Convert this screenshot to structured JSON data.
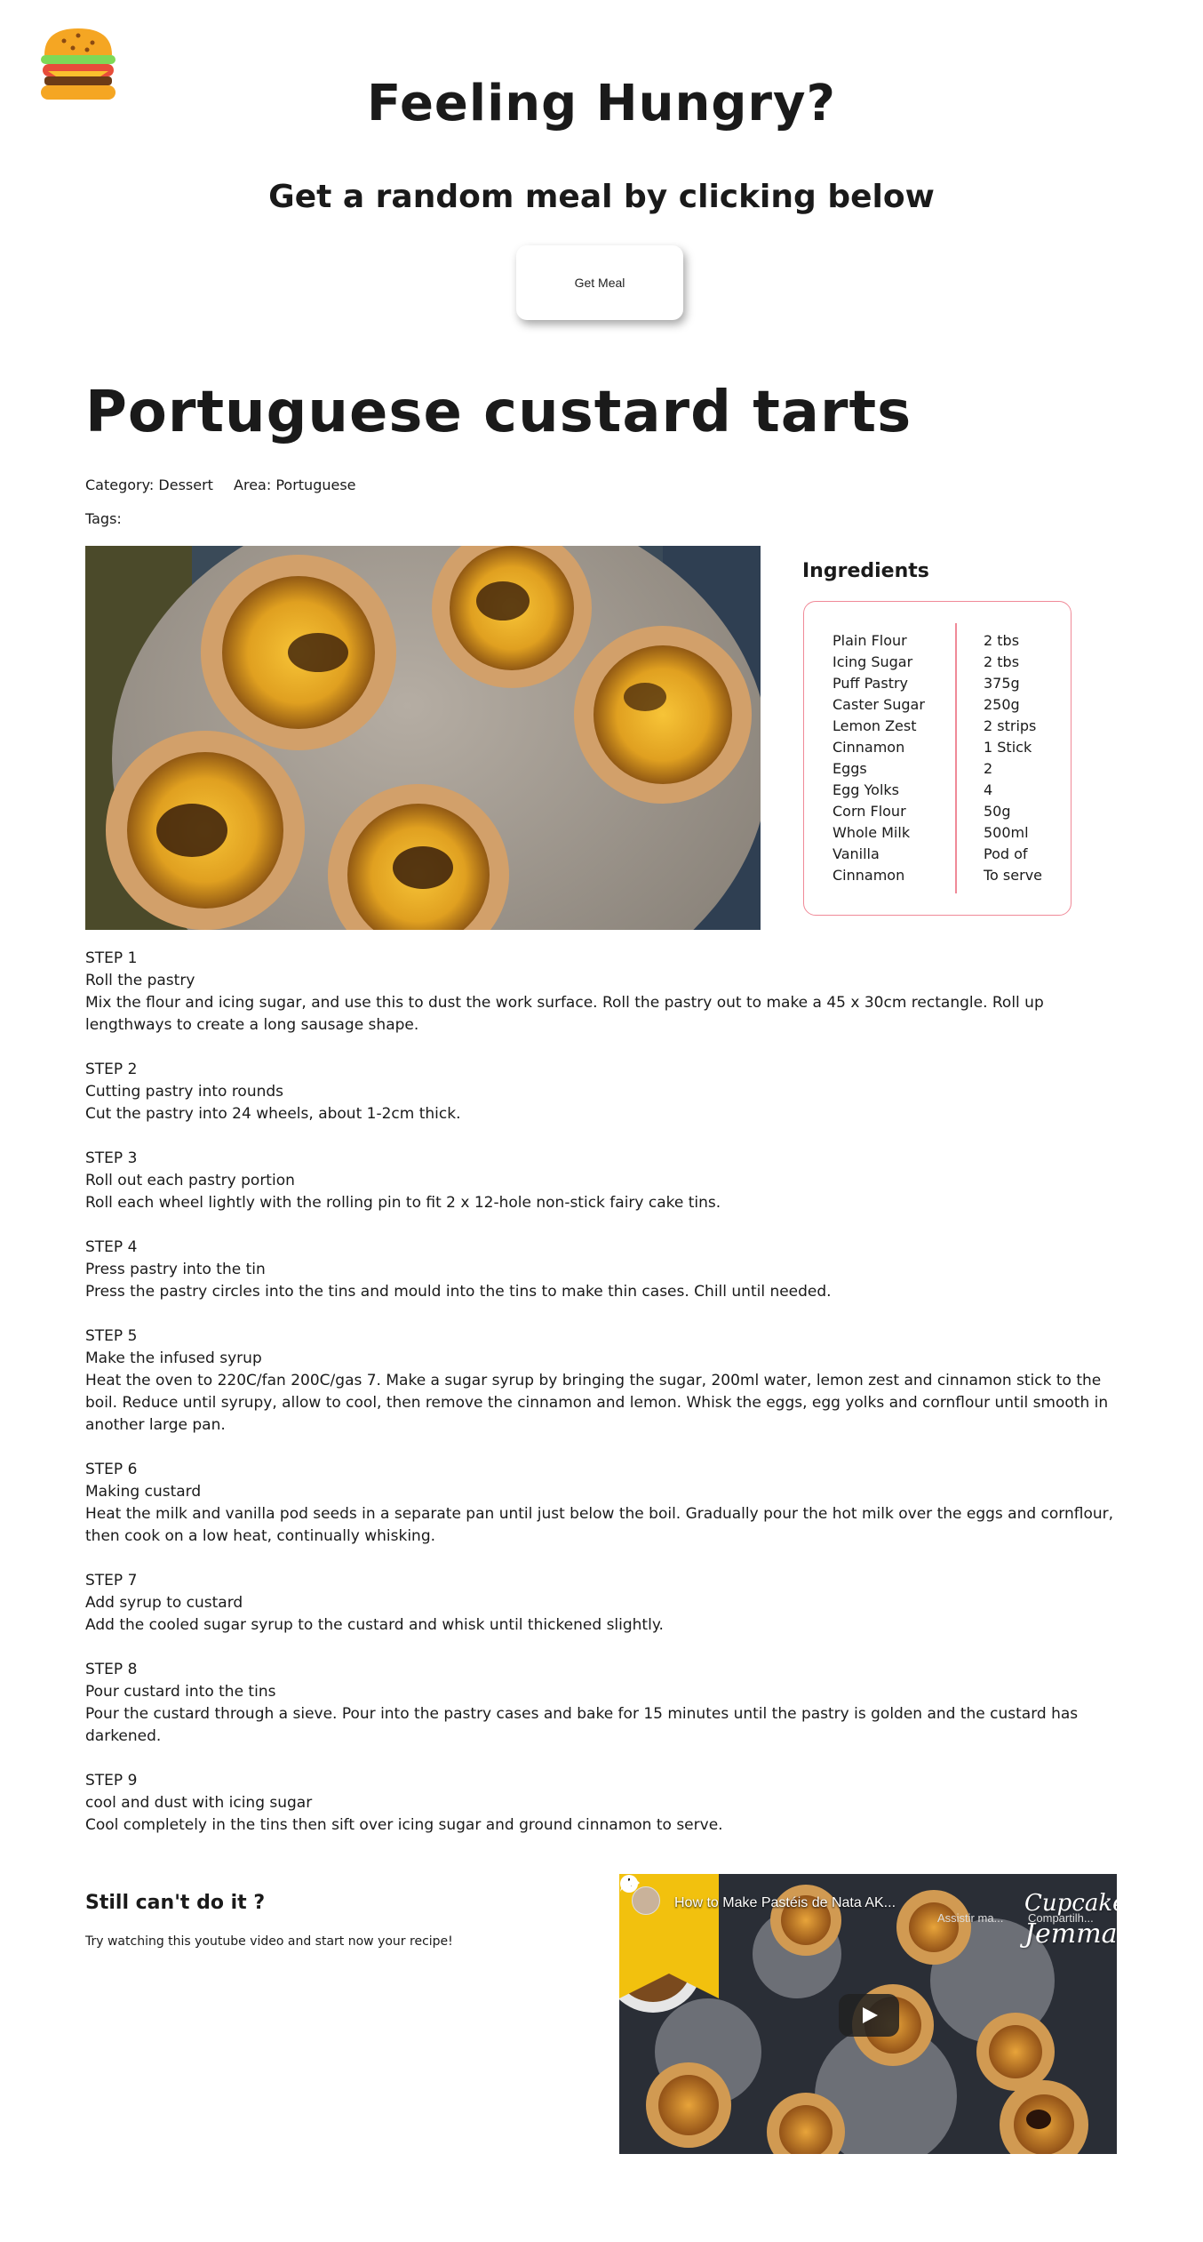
{
  "header": {
    "title": "Feeling Hungry?",
    "subtitle": "Get a random meal by clicking below",
    "button_label": "Get Meal",
    "logo_icon": "burger-icon"
  },
  "meal": {
    "name": "Portuguese custard tarts",
    "category": "Category: Dessert",
    "area": "Area: Portuguese",
    "tags": "Tags:",
    "ingredients_heading": "Ingredients",
    "accent_color": "#f08a98",
    "ingredients": [
      {
        "name": "Plain Flour",
        "measure": "2 tbs"
      },
      {
        "name": "Icing Sugar",
        "measure": "2 tbs"
      },
      {
        "name": "Puff Pastry",
        "measure": "375g"
      },
      {
        "name": "Caster Sugar",
        "measure": "250g"
      },
      {
        "name": "Lemon Zest",
        "measure": "2 strips"
      },
      {
        "name": "Cinnamon",
        "measure": "1 Stick"
      },
      {
        "name": "Eggs",
        "measure": "2"
      },
      {
        "name": "Egg Yolks",
        "measure": "4"
      },
      {
        "name": "Corn Flour",
        "measure": "50g"
      },
      {
        "name": "Whole Milk",
        "measure": "500ml"
      },
      {
        "name": "Vanilla",
        "measure": "Pod of"
      },
      {
        "name": "Cinnamon",
        "measure": "To serve"
      }
    ],
    "steps": [
      {
        "label": "STEP 1",
        "title": "Roll the pastry",
        "text": "Mix the flour and icing sugar, and use this to dust the work surface. Roll the pastry out to make a 45 x 30cm rectangle. Roll up lengthways to create a long sausage shape."
      },
      {
        "label": "STEP 2",
        "title": "Cutting pastry into rounds",
        "text": "Cut the pastry into 24 wheels, about 1-2cm thick."
      },
      {
        "label": "STEP 3",
        "title": "Roll out each pastry portion",
        "text": "Roll each wheel lightly with the rolling pin to fit 2 x 12-hole non-stick fairy cake tins."
      },
      {
        "label": "STEP 4",
        "title": "Press pastry into the tin",
        "text": "Press the pastry circles into the tins and mould into the tins to make thin cases. Chill until needed."
      },
      {
        "label": "STEP 5",
        "title": "Make the infused syrup",
        "text": "Heat the oven to 220C/fan 200C/gas 7. Make a sugar syrup by bringing the sugar, 200ml water, lemon zest and cinnamon stick to the boil. Reduce until syrupy, allow to cool, then remove the cinnamon and lemon. Whisk the eggs, egg yolks and cornflour until smooth in another large pan."
      },
      {
        "label": "STEP 6",
        "title": "Making custard",
        "text": "Heat the milk and vanilla pod seeds in a separate pan until just below the boil. Gradually pour the hot milk over the eggs and cornflour, then cook on a low heat, continually whisking."
      },
      {
        "label": "STEP 7",
        "title": "Add syrup to custard",
        "text": "Add the cooled sugar syrup to the custard and whisk until thickened slightly."
      },
      {
        "label": "STEP 8",
        "title": "Pour custard into the tins",
        "text": "Pour the custard through a sieve. Pour into the pastry cases and bake for 15 minutes until the pastry is golden and the custard has darkened."
      },
      {
        "label": "STEP 9",
        "title": "cool and dust with icing sugar",
        "text": "Cool completely in the tins then sift over icing sugar and ground cinnamon to serve."
      }
    ]
  },
  "video_section": {
    "heading": "Still can't do it ?",
    "text": "Try watching this youtube video and start now your recipe!",
    "video_title": "How to Make Pastéis de Nata AK...",
    "watch_later": "Assistir ma...",
    "share": "Compartilh...",
    "channel_line1": "Cupcake",
    "channel_line2": "Jemma"
  }
}
